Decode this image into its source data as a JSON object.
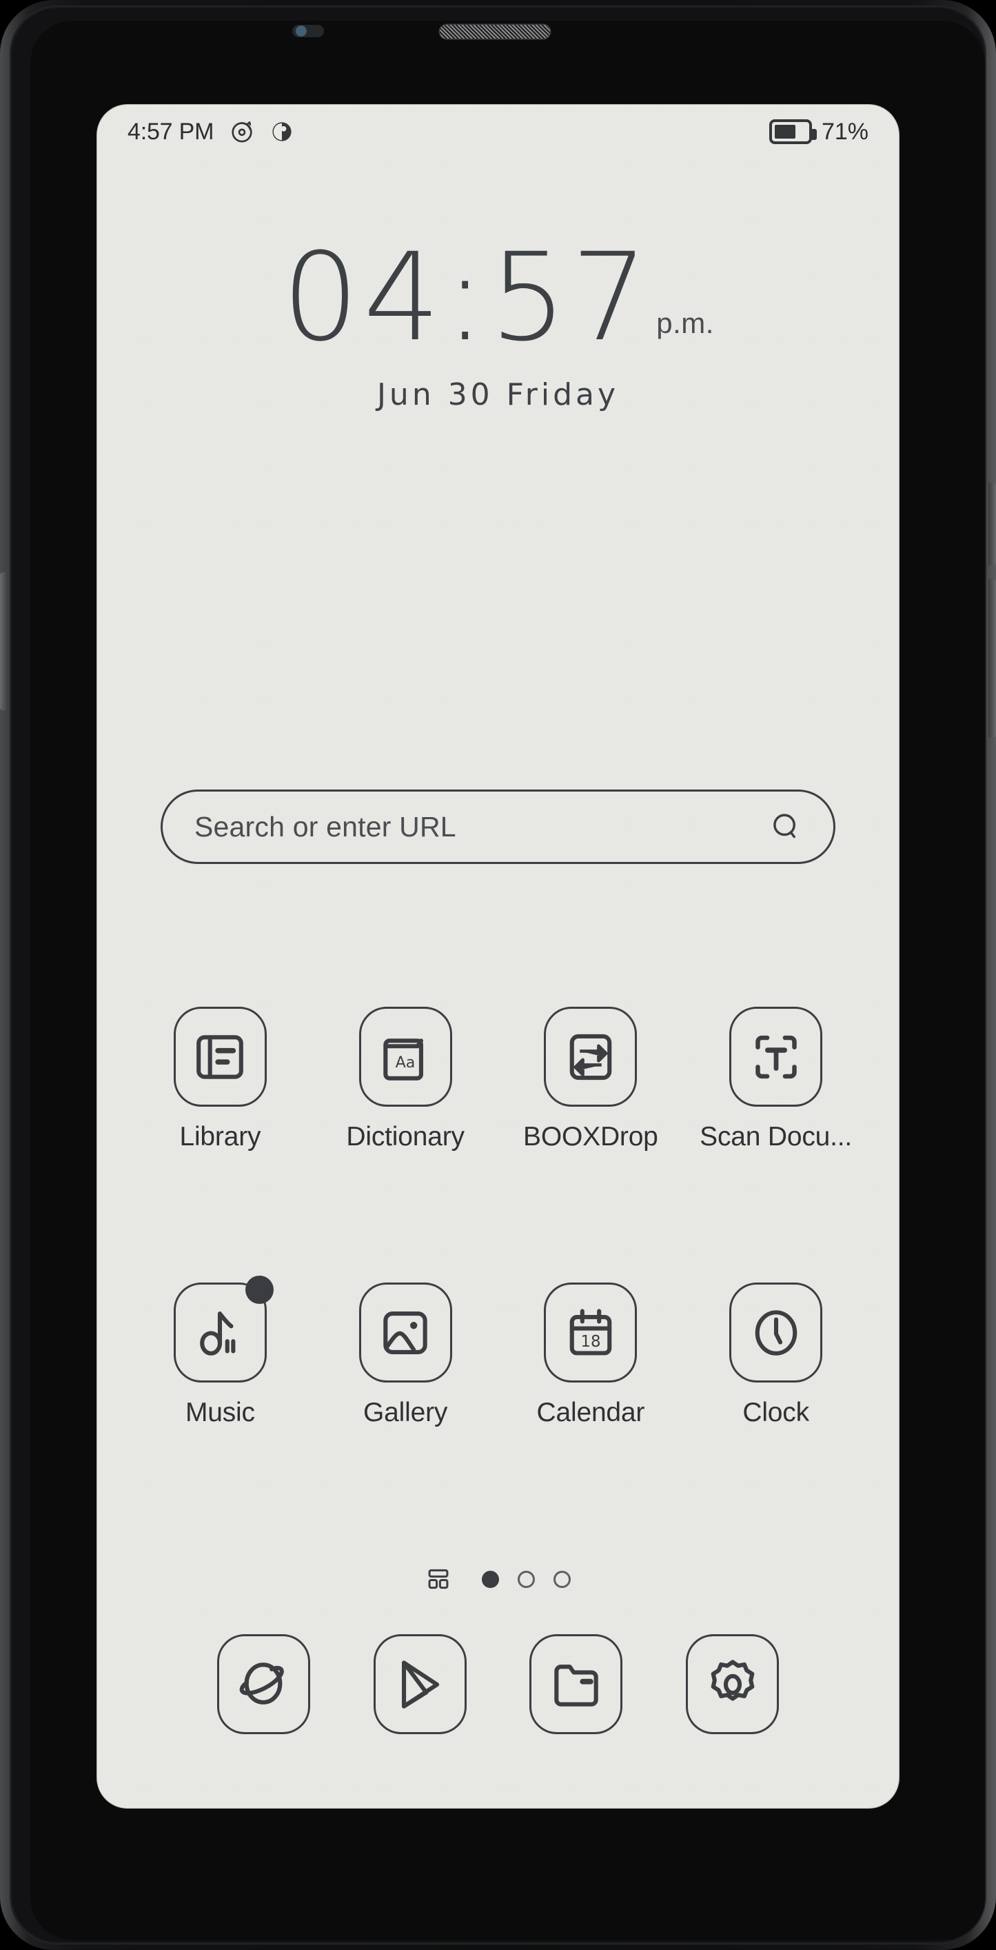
{
  "device": {
    "front_sensor": "front-camera-sensor",
    "earpiece": "earpiece-speaker"
  },
  "status_bar": {
    "time": "4:57 PM",
    "icons": [
      {
        "name": "refresh-mode-icon"
      },
      {
        "name": "contrast-mode-icon"
      }
    ],
    "battery": {
      "icon": "battery-icon",
      "level_percent": 71,
      "label": "71%"
    }
  },
  "clock_widget": {
    "time": "04:57",
    "meridiem": "p.m.",
    "date": "Jun 30 Friday"
  },
  "search": {
    "placeholder": "Search or enter URL",
    "icon": "search-icon"
  },
  "apps": {
    "row1": [
      {
        "label": "Library",
        "icon": "library-icon",
        "badge": false
      },
      {
        "label": "Dictionary",
        "icon": "dictionary-icon",
        "badge": false
      },
      {
        "label": "BOOXDrop",
        "icon": "booxdrop-icon",
        "badge": false
      },
      {
        "label": "Scan Docu...",
        "icon": "scan-document-icon",
        "badge": false
      }
    ],
    "row2": [
      {
        "label": "Music",
        "icon": "music-icon",
        "badge": true
      },
      {
        "label": "Gallery",
        "icon": "gallery-icon",
        "badge": false
      },
      {
        "label": "Calendar",
        "icon": "calendar-icon",
        "badge": false,
        "day_number": "18"
      },
      {
        "label": "Clock",
        "icon": "clock-icon",
        "badge": false
      }
    ]
  },
  "page_indicator": {
    "layout_icon": "layout-grid-icon",
    "total_pages": 3,
    "active_page": 1
  },
  "dock": [
    {
      "label": "Browser",
      "icon": "planet-browser-icon"
    },
    {
      "label": "Play Store",
      "icon": "play-store-icon"
    },
    {
      "label": "File Manager",
      "icon": "folder-icon"
    },
    {
      "label": "Settings",
      "icon": "gear-icon"
    }
  ],
  "colors": {
    "screen_background": "#e9eae5",
    "ink": "#3c3e42",
    "ink_strong": "#2f3135",
    "device_body": "#121315"
  }
}
